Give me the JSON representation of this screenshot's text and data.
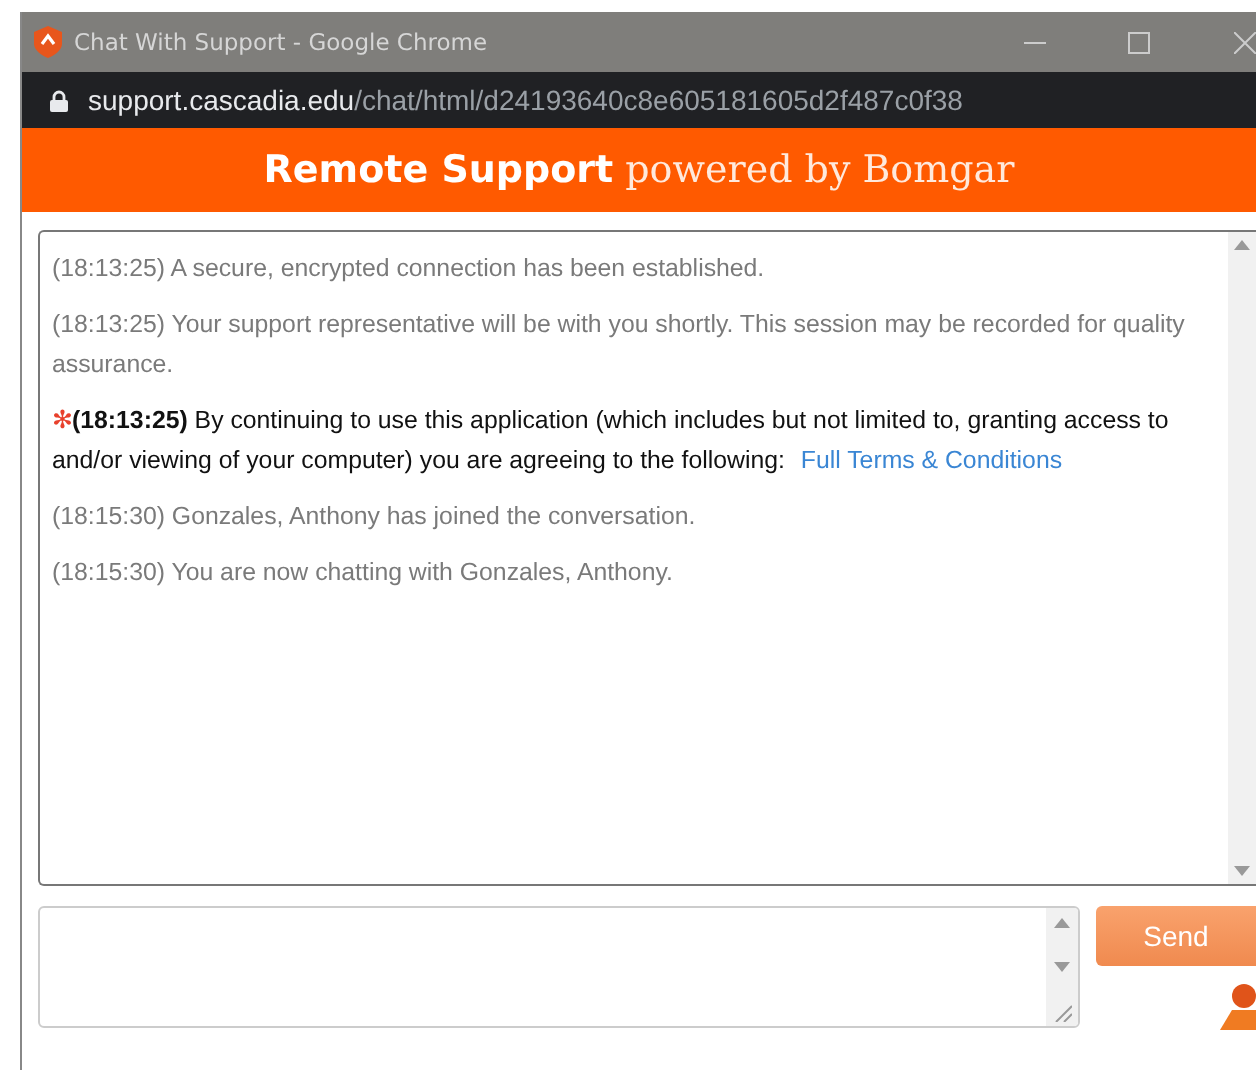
{
  "window": {
    "title": "Chat With Support - Google Chrome"
  },
  "address_bar": {
    "host": "support.cascadia.edu",
    "path": "/chat/html/d24193640c8e605181605d2f487c0f38"
  },
  "header": {
    "title": "Remote Support",
    "subtitle": "powered by Bomgar"
  },
  "messages": [
    {
      "kind": "system",
      "text": "(18:13:25) A secure, encrypted connection has been established."
    },
    {
      "kind": "system",
      "text": "(18:13:25) Your support representative will be with you shortly. This session may be recorded for quality assurance."
    },
    {
      "kind": "notice",
      "mark": "✻",
      "text": "**(18:13:25)** By continuing to use this application (which includes but not limited to, granting access to and/or viewing of your computer) you are agreeing to the following:",
      "link": "Full Terms & Conditions"
    },
    {
      "kind": "system",
      "text": "(18:15:30) Gonzales, Anthony has joined the conversation."
    },
    {
      "kind": "system",
      "text": "(18:15:30) You are now chatting with Gonzales, Anthony."
    }
  ],
  "send_button": {
    "label": "Send"
  }
}
